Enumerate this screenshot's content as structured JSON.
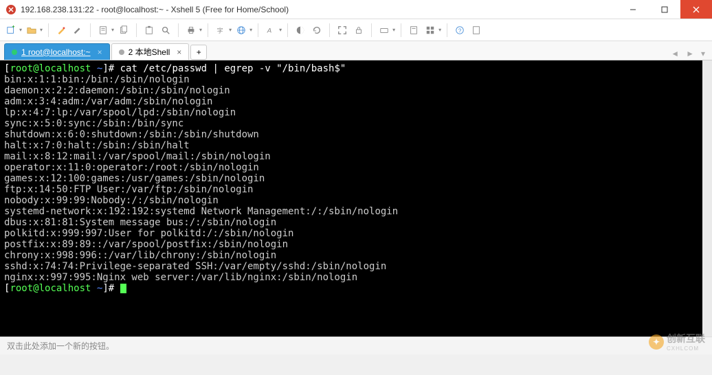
{
  "window": {
    "title": "192.168.238.131:22 - root@localhost:~ - Xshell 5 (Free for Home/School)"
  },
  "tabs": {
    "t1": "1 root@localhost:~",
    "t2": "2 本地Shell",
    "add": "+"
  },
  "terminal": {
    "prompt_user": "root",
    "prompt_at": "@",
    "prompt_host": "localhost",
    "prompt_tilde": " ~",
    "prompt_open": "[",
    "prompt_close": "]# ",
    "command": "cat /etc/passwd | egrep -v \"/bin/bash$\"",
    "lines": [
      "bin:x:1:1:bin:/bin:/sbin/nologin",
      "daemon:x:2:2:daemon:/sbin:/sbin/nologin",
      "adm:x:3:4:adm:/var/adm:/sbin/nologin",
      "lp:x:4:7:lp:/var/spool/lpd:/sbin/nologin",
      "sync:x:5:0:sync:/sbin:/bin/sync",
      "shutdown:x:6:0:shutdown:/sbin:/sbin/shutdown",
      "halt:x:7:0:halt:/sbin:/sbin/halt",
      "mail:x:8:12:mail:/var/spool/mail:/sbin/nologin",
      "operator:x:11:0:operator:/root:/sbin/nologin",
      "games:x:12:100:games:/usr/games:/sbin/nologin",
      "ftp:x:14:50:FTP User:/var/ftp:/sbin/nologin",
      "nobody:x:99:99:Nobody:/:/sbin/nologin",
      "systemd-network:x:192:192:systemd Network Management:/:/sbin/nologin",
      "dbus:x:81:81:System message bus:/:/sbin/nologin",
      "polkitd:x:999:997:User for polkitd:/:/sbin/nologin",
      "postfix:x:89:89::/var/spool/postfix:/sbin/nologin",
      "chrony:x:998:996::/var/lib/chrony:/sbin/nologin",
      "sshd:x:74:74:Privilege-separated SSH:/var/empty/sshd:/sbin/nologin",
      "nginx:x:997:995:Nginx web server:/var/lib/nginx:/sbin/nologin"
    ]
  },
  "status": {
    "hint": "双击此处添加一个新的按钮。"
  },
  "watermark": {
    "brand": "创新互联",
    "sub": "CXHLCOM"
  }
}
